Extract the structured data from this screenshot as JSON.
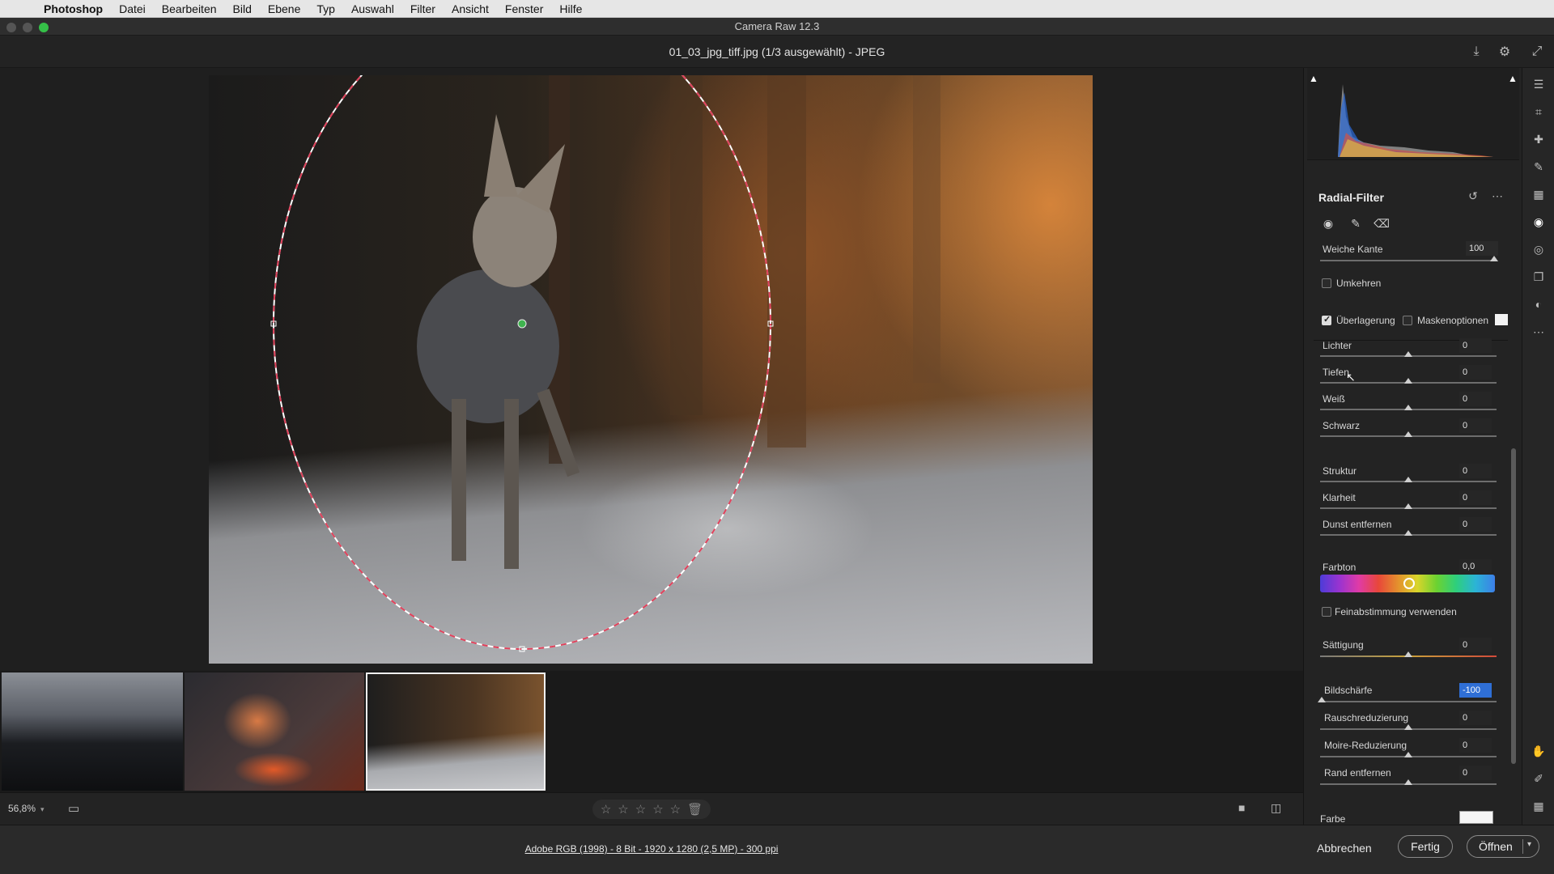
{
  "menubar": {
    "app": "Photoshop",
    "items": [
      "Datei",
      "Bearbeiten",
      "Bild",
      "Ebene",
      "Typ",
      "Auswahl",
      "Filter",
      "Ansicht",
      "Fenster",
      "Hilfe"
    ]
  },
  "window": {
    "title": "Camera Raw 12.3"
  },
  "file": {
    "header": "01_03_jpg_tiff.jpg (1/3 ausgewählt) - JPEG"
  },
  "bottom": {
    "zoom": "56,8%"
  },
  "footer": {
    "file_info": "Adobe RGB (1998) - 8 Bit - 1920 x 1280 (2,5 MP) - 300 ppi",
    "cancel": "Abbrechen",
    "done": "Fertig",
    "open": "Öffnen"
  },
  "panel": {
    "title": "Radial-Filter",
    "feather": {
      "label": "Weiche Kante",
      "value": "100"
    },
    "invert": {
      "label": "Umkehren",
      "checked": false
    },
    "overlay": {
      "label": "Überlagerung",
      "checked": true
    },
    "mask_options": {
      "label": "Maskenoptionen",
      "checked": false
    },
    "sliders": [
      {
        "label": "Lichter",
        "value": "0"
      },
      {
        "label": "Tiefen",
        "value": "0"
      },
      {
        "label": "Weiß",
        "value": "0"
      },
      {
        "label": "Schwarz",
        "value": "0"
      },
      {
        "label": "Struktur",
        "value": "0"
      },
      {
        "label": "Klarheit",
        "value": "0"
      },
      {
        "label": "Dunst entfernen",
        "value": "0"
      }
    ],
    "hue": {
      "label": "Farbton",
      "value": "0,0"
    },
    "fine_tune": {
      "label": "Feinabstimmung verwenden",
      "checked": false
    },
    "saturation": {
      "label": "Sättigung",
      "value": "0"
    },
    "detail_sliders": [
      {
        "label": "Bildschärfe",
        "value": "-100"
      },
      {
        "label": "Rauschreduzierung",
        "value": "0"
      },
      {
        "label": "Moire-Reduzierung",
        "value": "0"
      },
      {
        "label": "Rand entfernen",
        "value": "0"
      }
    ],
    "color": {
      "label": "Farbe"
    }
  },
  "colors": {
    "accent": "#2f6fd6",
    "mask_line": "#e0415b"
  }
}
